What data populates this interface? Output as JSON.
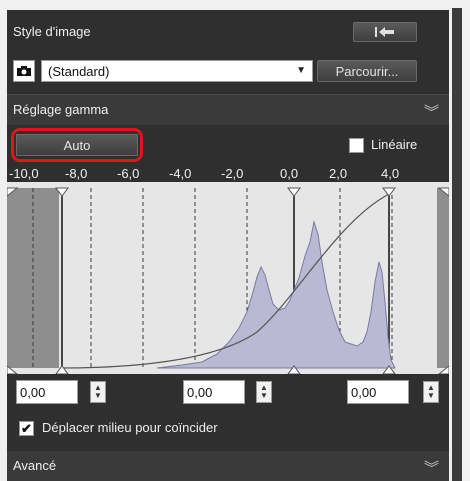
{
  "picture_style": {
    "title": "Style d'image",
    "selected_style": "(Standard)",
    "browse_label": "Parcourir..."
  },
  "gamma": {
    "title": "Réglage gamma",
    "auto_label": "Auto",
    "linear_label": "Linéaire",
    "linear_checked": false,
    "ticks": [
      "-10,0",
      "-8,0",
      "-6,0",
      "-4,0",
      "-2,0",
      "0,0",
      "2,0",
      "4,0"
    ],
    "value_left": "0,00",
    "value_middle": "0,00",
    "value_right": "0,00",
    "move_middle_label": "Déplacer milieu pour coïncider",
    "move_middle_checked": true
  },
  "advanced": {
    "title": "Avancé"
  },
  "colors": {
    "panel": "#2f2f2f",
    "histogram_fill": "#b9b9d4",
    "highlight": "#e3141b"
  }
}
